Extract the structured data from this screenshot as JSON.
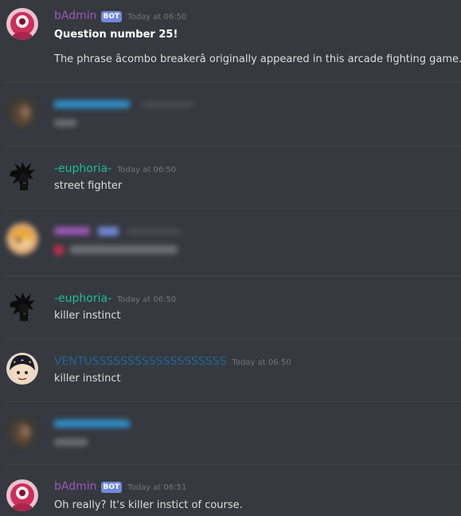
{
  "colors": {
    "background": "#36393f",
    "admin_username": "#9b59b6",
    "euphoria_username": "#1abc9c",
    "ventus_username": "#206694",
    "blurred_username": "#2f8ec9",
    "bot_tag": "#7289da",
    "timestamp": "#72767d",
    "text": "#dcddde"
  },
  "messages": [
    {
      "username": "bAdmin",
      "bot_tag": "BOT",
      "timestamp": "Today at 06:50",
      "lines": [
        "Question number 25!",
        "The phrase âcombo breakerâ originally appeared in this arcade fighting game."
      ]
    },
    {
      "blurred": true
    },
    {
      "username": "-euphoria-",
      "timestamp": "Today at 06:50",
      "lines": [
        "street fighter"
      ]
    },
    {
      "blurred": true
    },
    {
      "username": "-euphoria-",
      "timestamp": "Today at 06:50",
      "lines": [
        "killer instinct"
      ]
    },
    {
      "username": "VENTUSSSSSSSSSSSSSSSSSSS",
      "timestamp": "Today at 06:50",
      "lines": [
        "killer instinct"
      ]
    },
    {
      "blurred": true
    },
    {
      "username": "bAdmin",
      "bot_tag": "BOT",
      "timestamp": "Today at 06:51",
      "lines": [
        "Oh really? It's killer instict of course."
      ]
    }
  ],
  "icons": {
    "admin_avatar": "pink-eye-creature-icon",
    "euphoria_avatar": "spiky-hair-character-icon",
    "ventus_avatar": "anime-face-icon"
  }
}
